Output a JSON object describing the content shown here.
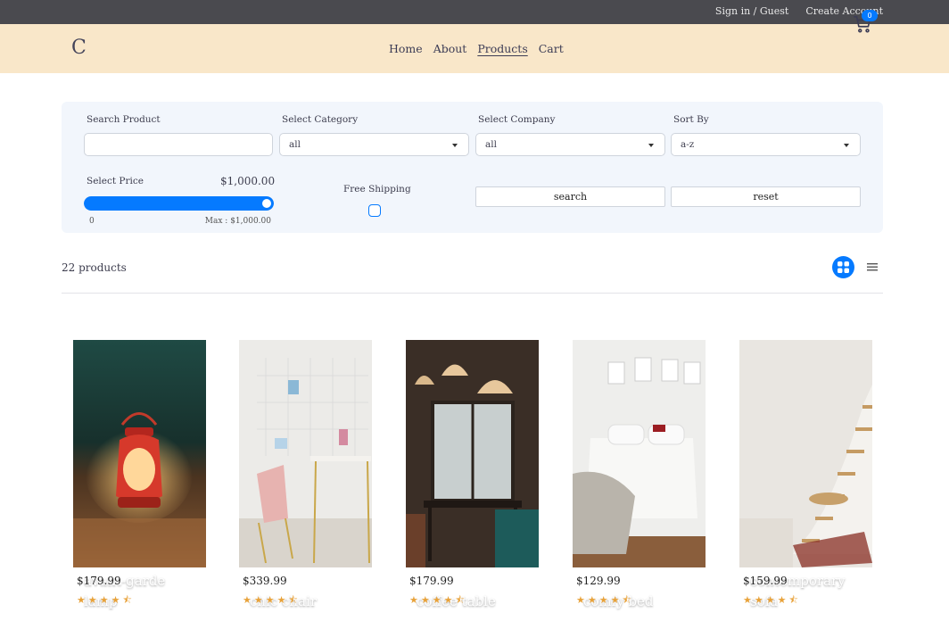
{
  "topbar": {
    "sign_in": "Sign in / Guest",
    "create_account": "Create Account"
  },
  "nav": {
    "logo": "C",
    "links": [
      "Home",
      "About",
      "Products",
      "Cart"
    ],
    "active_link": "Products",
    "cart_count": "0",
    "cart_icon": "shopping-cart-icon"
  },
  "filters": {
    "search_label": "Search Product",
    "search_value": "",
    "category_label": "Select Category",
    "category_value": "all",
    "company_label": "Select Company",
    "company_value": "all",
    "sort_label": "Sort By",
    "sort_value": "a-z",
    "price_label": "Select Price",
    "price_value": "$1,000.00",
    "price_min": "0",
    "price_max_text": "Max : $1,000.00",
    "price_fill_fraction": 1.0,
    "free_shipping_label": "Free Shipping",
    "free_shipping_checked": false,
    "search_button": "search",
    "reset_button": "reset"
  },
  "results": {
    "count": "22 products",
    "view_grid_icon": "grid-icon",
    "view_list_icon": "list-icon",
    "active_view": "grid"
  },
  "products": [
    {
      "name": "avant-garde lamp",
      "price": "$179.99",
      "rating": 4.5
    },
    {
      "name": "chic chair",
      "price": "$339.99",
      "rating": 4.5
    },
    {
      "name": "coffee table",
      "price": "$179.99",
      "rating": 4.5
    },
    {
      "name": "comfy bed",
      "price": "$129.99",
      "rating": 4.5
    },
    {
      "name": "contemporary sofa",
      "price": "$159.99",
      "rating": 4.5
    }
  ],
  "colors": {
    "accent": "#057aff",
    "nav_bg": "#f9e7c9",
    "topbar_bg": "#4a4a4f",
    "star": "#e8a23a"
  }
}
